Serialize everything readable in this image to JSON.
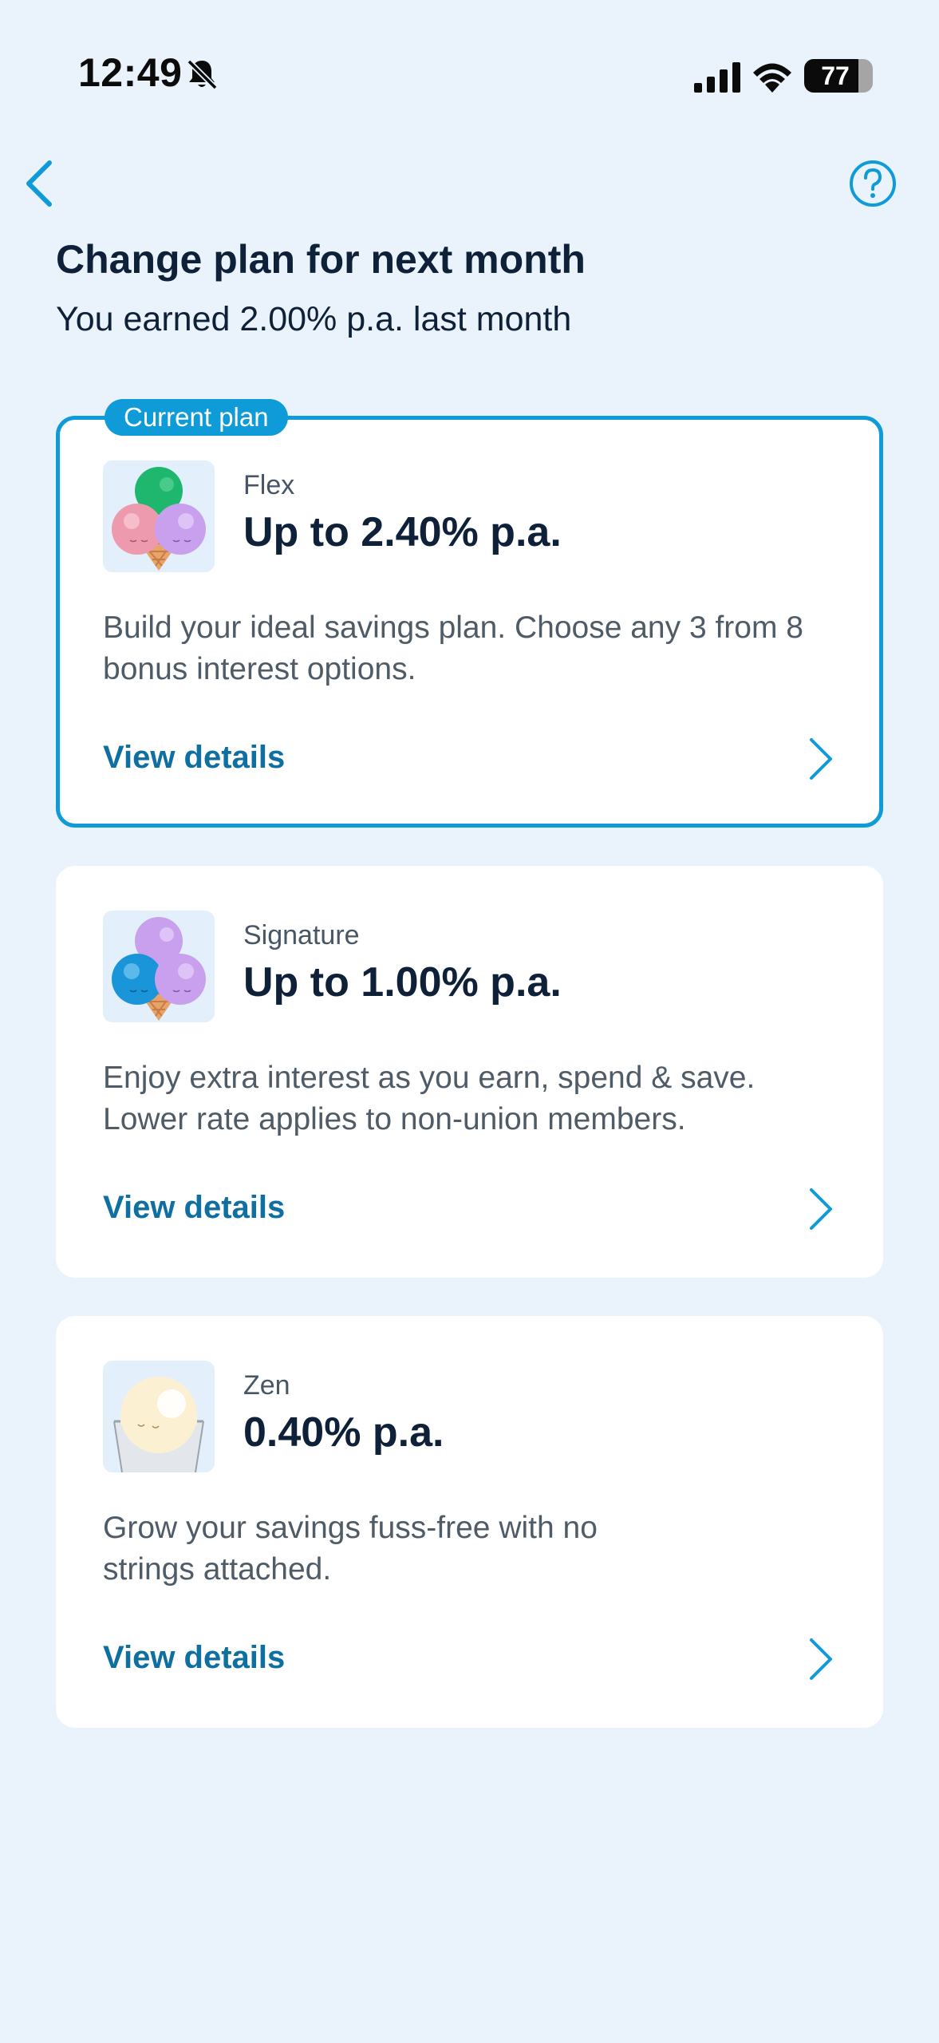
{
  "status_bar": {
    "time": "12:49",
    "battery": "77",
    "battery_level": 0.77,
    "icons": [
      "bell-slash-icon",
      "signal-icon",
      "wifi-icon",
      "battery-icon"
    ]
  },
  "nav": {
    "back_icon": "chevron-left-icon",
    "help_icon": "question-circle-icon"
  },
  "header": {
    "title": "Change plan for next month",
    "subtitle": "You earned 2.00% p.a. last month"
  },
  "colors": {
    "background": "#EAF3FC",
    "accent": "#0E9BD8",
    "link": "#0E6FA0",
    "text_dark": "#0E2138"
  },
  "plans": [
    {
      "badge": "Current plan",
      "name": "Flex",
      "rate": "Up to 2.40% p.a.",
      "description": "Build your ideal savings plan. Choose any 3 from 8 bonus interest options.",
      "link": "View details",
      "image": "ice-cream-three-scoops-green-pink-purple"
    },
    {
      "name": "Signature",
      "rate": "Up to 1.00% p.a.",
      "description": "Enjoy extra interest as you earn, spend & save. Lower rate applies to non-union members.",
      "link": "View details",
      "image": "ice-cream-three-scoops-purple-blue-purple"
    },
    {
      "name": "Zen",
      "rate": "0.40% p.a.",
      "description": "Grow your savings fuss-free with no strings attached.",
      "link": "View details",
      "image": "ice-cream-cup-vanilla"
    }
  ]
}
